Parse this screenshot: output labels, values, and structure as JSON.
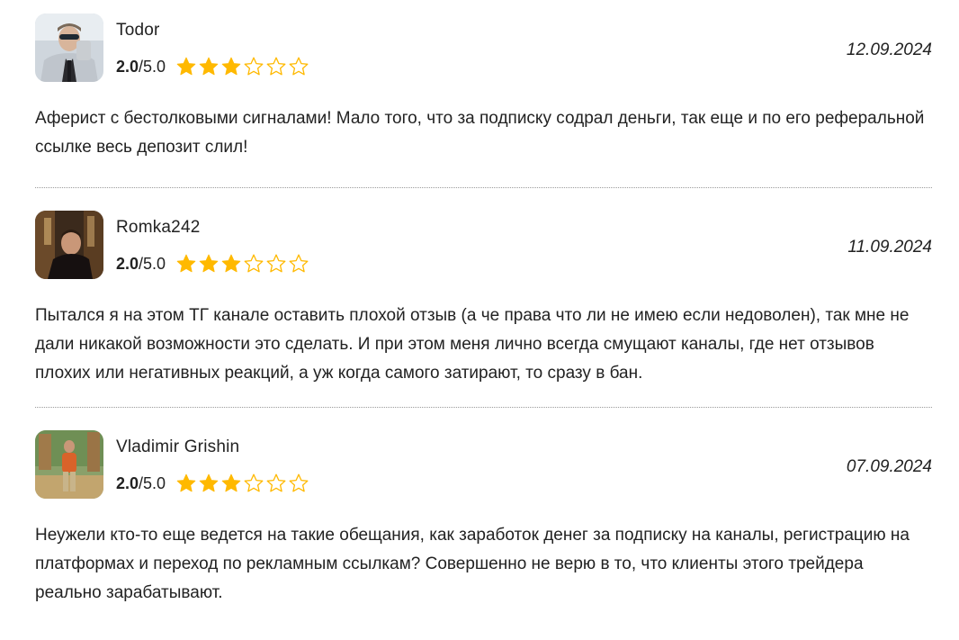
{
  "colors": {
    "star_filled": "#FFB900",
    "star_empty_stroke": "#FFB900",
    "text": "#222222",
    "divider": "#9a9a9a"
  },
  "reviews": [
    {
      "author": "Todor",
      "avatar_icon": "user-photo-icon",
      "rating_value": "2.0",
      "rating_max": "/5.0",
      "stars_filled": 3,
      "stars_total": 6,
      "date": "12.09.2024",
      "text": "Аферист с бестолковыми сигналами! Мало того, что за подписку содрал деньги, так еще и по его реферальной ссылке весь депозит слил!"
    },
    {
      "author": "Romka242",
      "avatar_icon": "user-photo-icon",
      "rating_value": "2.0",
      "rating_max": "/5.0",
      "stars_filled": 3,
      "stars_total": 6,
      "date": "11.09.2024",
      "text": "Пытался я на этом ТГ канале оставить плохой отзыв (а че права что ли не имею если недоволен), так мне не дали никакой возможности это сделать. И при этом меня лично всегда смущают каналы, где нет отзывов плохих или негативных реакций, а уж когда самого затирают, то сразу в бан."
    },
    {
      "author": "Vladimir Grishin",
      "avatar_icon": "user-photo-icon",
      "rating_value": "2.0",
      "rating_max": "/5.0",
      "stars_filled": 3,
      "stars_total": 6,
      "date": "07.09.2024",
      "text": "Неужели кто-то еще ведется на такие обещания, как заработок денег за подписку на каналы, регистрацию на платформах и переход по рекламным ссылкам? Совершенно не верю в то, что клиенты этого трейдера реально зарабатывают."
    }
  ]
}
